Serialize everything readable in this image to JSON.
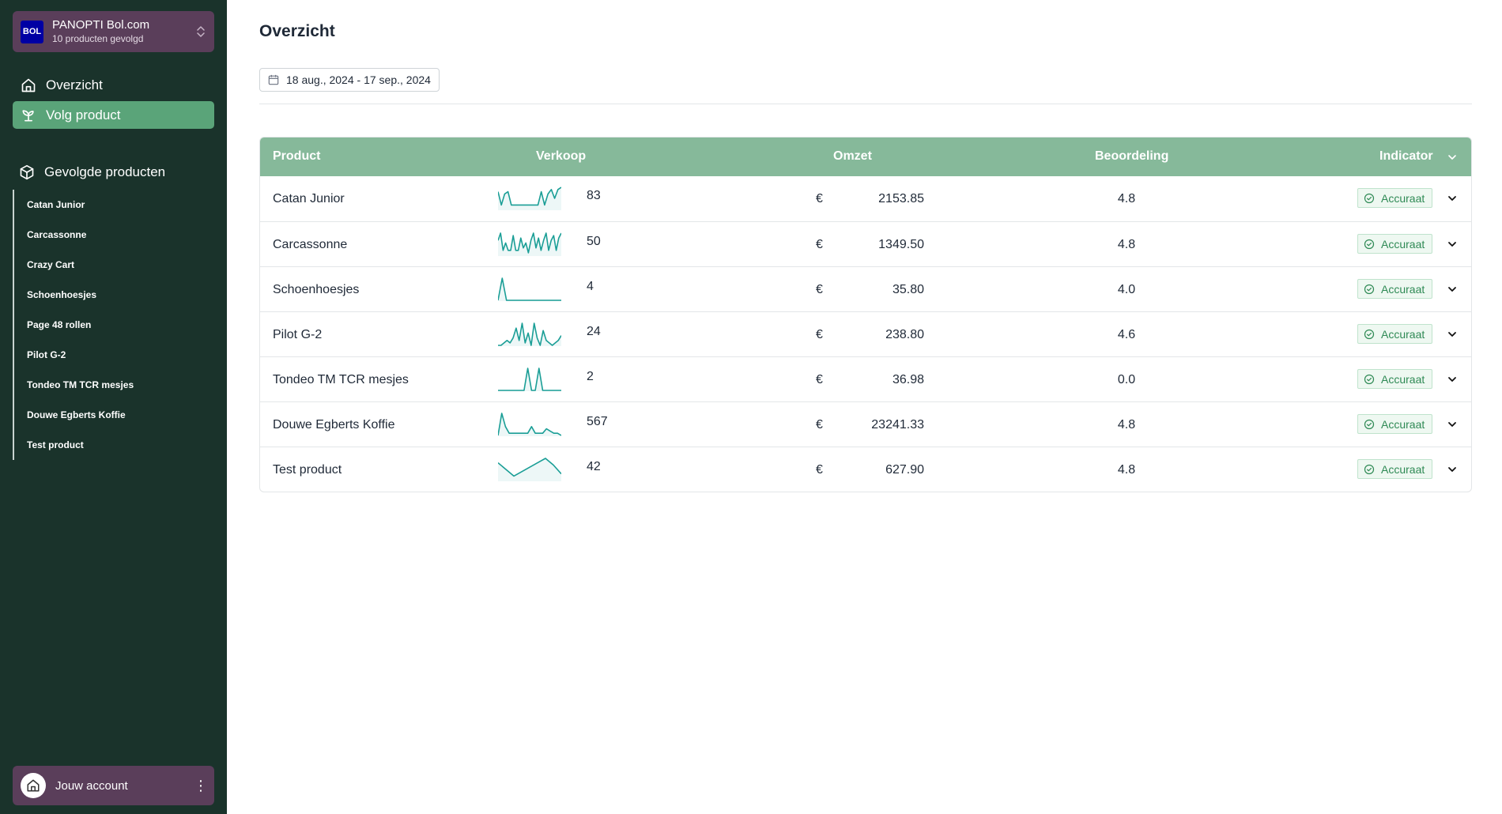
{
  "sidebar": {
    "store": {
      "logo": "BOL",
      "name": "PANOPTI Bol.com",
      "subtitle": "10 producten gevolgd",
      "icon": "chevron-up-down-icon"
    },
    "nav": [
      {
        "label": "Overzicht",
        "icon": "home-icon"
      },
      {
        "label": "Volg product",
        "icon": "sprout-icon",
        "active": true
      }
    ],
    "section_title": "Gevolgde producten",
    "section_icon": "package-icon",
    "tracked": [
      "Catan Junior",
      "Carcassonne",
      "Crazy Cart",
      "Schoenhoesjes",
      "Page 48 rollen",
      "Pilot G-2",
      "Tondeo TM TCR mesjes",
      "Douwe Egberts Koffie",
      "Test product"
    ],
    "account": {
      "label": "Jouw account",
      "icon": "home-icon",
      "menu_icon": "kebab-icon"
    }
  },
  "main": {
    "title": "Overzicht",
    "date_range": "18 aug., 2024 - 17 sep., 2024",
    "date_icon": "calendar-icon"
  },
  "table": {
    "headers": {
      "product": "Product",
      "verkoop": "Verkoop",
      "omzet": "Omzet",
      "beoordeling": "Beoordeling",
      "indicator": "Indicator"
    },
    "currency": "€",
    "rows": [
      {
        "product": "Catan Junior",
        "verkoop": "83",
        "omzet": "2153.85",
        "rating": "4.8",
        "indicator": "Accuraat",
        "spark": [
          8,
          2,
          7,
          8,
          2,
          2,
          2,
          2,
          2,
          2,
          2,
          2,
          2,
          8,
          2,
          7,
          9,
          5,
          9,
          10
        ]
      },
      {
        "product": "Carcassonne",
        "verkoop": "50",
        "omzet": "1349.50",
        "rating": "4.8",
        "indicator": "Accuraat",
        "spark": [
          6,
          9,
          2,
          5,
          2,
          2,
          8,
          2,
          2,
          7,
          3,
          5,
          1,
          6,
          9,
          3,
          7,
          2,
          6,
          9,
          2,
          6,
          8,
          2,
          7,
          9
        ]
      },
      {
        "product": "Schoenhoesjes",
        "verkoop": "4",
        "omzet": "35.80",
        "rating": "4.0",
        "indicator": "Accuraat",
        "spark": [
          0,
          10,
          0,
          0,
          0,
          0,
          0,
          0,
          0,
          0,
          0,
          0,
          0,
          0,
          0,
          0
        ]
      },
      {
        "product": "Pilot G-2",
        "verkoop": "24",
        "omzet": "238.80",
        "rating": "4.6",
        "indicator": "Accuraat",
        "spark": [
          0,
          0,
          1,
          2,
          1,
          3,
          7,
          2,
          9,
          1,
          5,
          0,
          9,
          3,
          0,
          6,
          2,
          1,
          0,
          1,
          2,
          4
        ]
      },
      {
        "product": "Tondeo TM TCR mesjes",
        "verkoop": "2",
        "omzet": "36.98",
        "rating": "0.0",
        "indicator": "Accuraat",
        "spark": [
          0,
          0,
          0,
          0,
          0,
          0,
          0,
          0,
          10,
          0,
          0,
          10,
          0,
          0,
          0,
          0,
          0,
          0
        ]
      },
      {
        "product": "Douwe Egberts Koffie",
        "verkoop": "567",
        "omzet": "23241.33",
        "rating": "4.8",
        "indicator": "Accuraat",
        "spark": [
          0,
          10,
          4,
          1,
          1,
          1,
          1,
          1,
          1,
          4,
          1,
          1,
          1,
          3,
          2,
          1,
          1,
          0
        ]
      },
      {
        "product": "Test product",
        "verkoop": "42",
        "omzet": "627.90",
        "rating": "4.8",
        "indicator": "Accuraat",
        "spark": [
          8,
          5,
          2,
          4,
          6,
          8,
          10,
          7,
          3
        ]
      }
    ],
    "accent_color": "#86b99a",
    "spark_color": "#1a9e96",
    "badge_icon": "check-circle-icon",
    "row_toggle_icon": "chevron-down-icon"
  }
}
